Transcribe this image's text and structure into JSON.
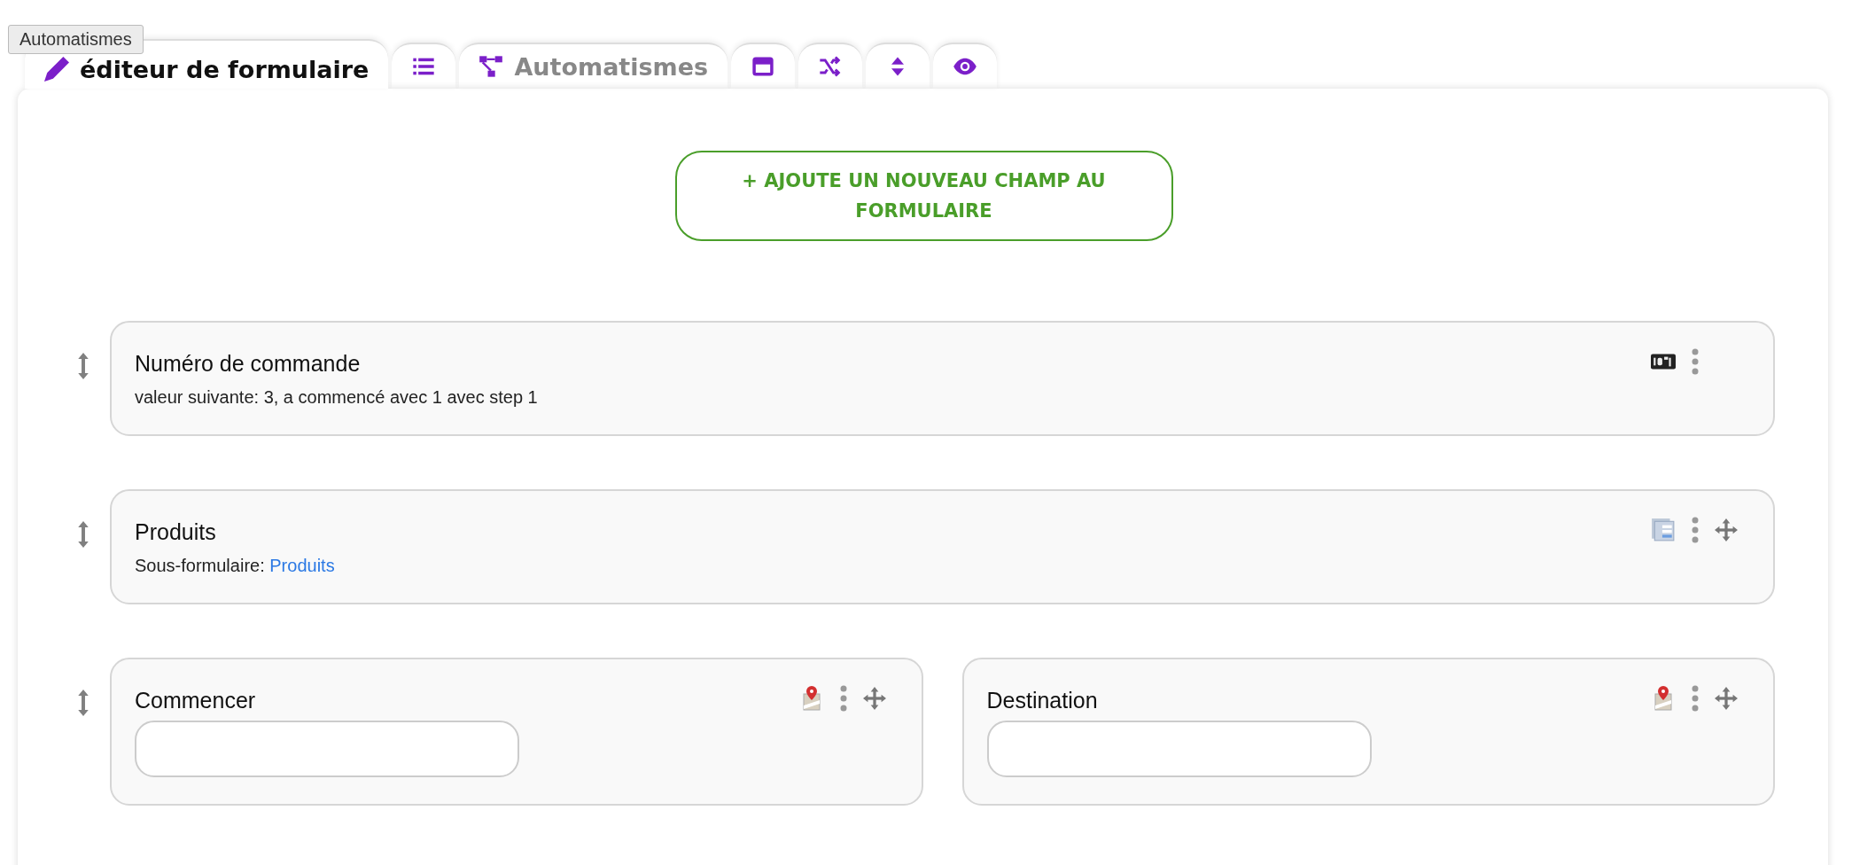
{
  "tooltip": "Automatismes",
  "tabs": [
    {
      "kind": "editor",
      "label": "éditeur de formulaire",
      "selected": true
    },
    {
      "kind": "list",
      "selected": false
    },
    {
      "kind": "automation",
      "label": "Automatismes",
      "selected": false
    },
    {
      "kind": "window",
      "selected": false
    },
    {
      "kind": "shuffle",
      "selected": false
    },
    {
      "kind": "sort",
      "selected": false
    },
    {
      "kind": "preview",
      "selected": false
    }
  ],
  "add_button": "+ AJOUTE UN NOUVEAU CHAMP AU FORMULAIRE",
  "rows": [
    {
      "fields": [
        {
          "kind": "counter",
          "title": "Numéro de commande",
          "description": "valeur suivante: 3, a commencé avec 1 avec step 1",
          "movable": false
        }
      ]
    },
    {
      "fields": [
        {
          "kind": "subform",
          "title": "Produits",
          "description": "Sous-formulaire: ",
          "link": "Produits",
          "movable": true
        }
      ]
    },
    {
      "fields": [
        {
          "kind": "location",
          "title": "Commencer",
          "movable": true
        },
        {
          "kind": "location",
          "title": "Destination",
          "movable": true
        }
      ]
    }
  ]
}
